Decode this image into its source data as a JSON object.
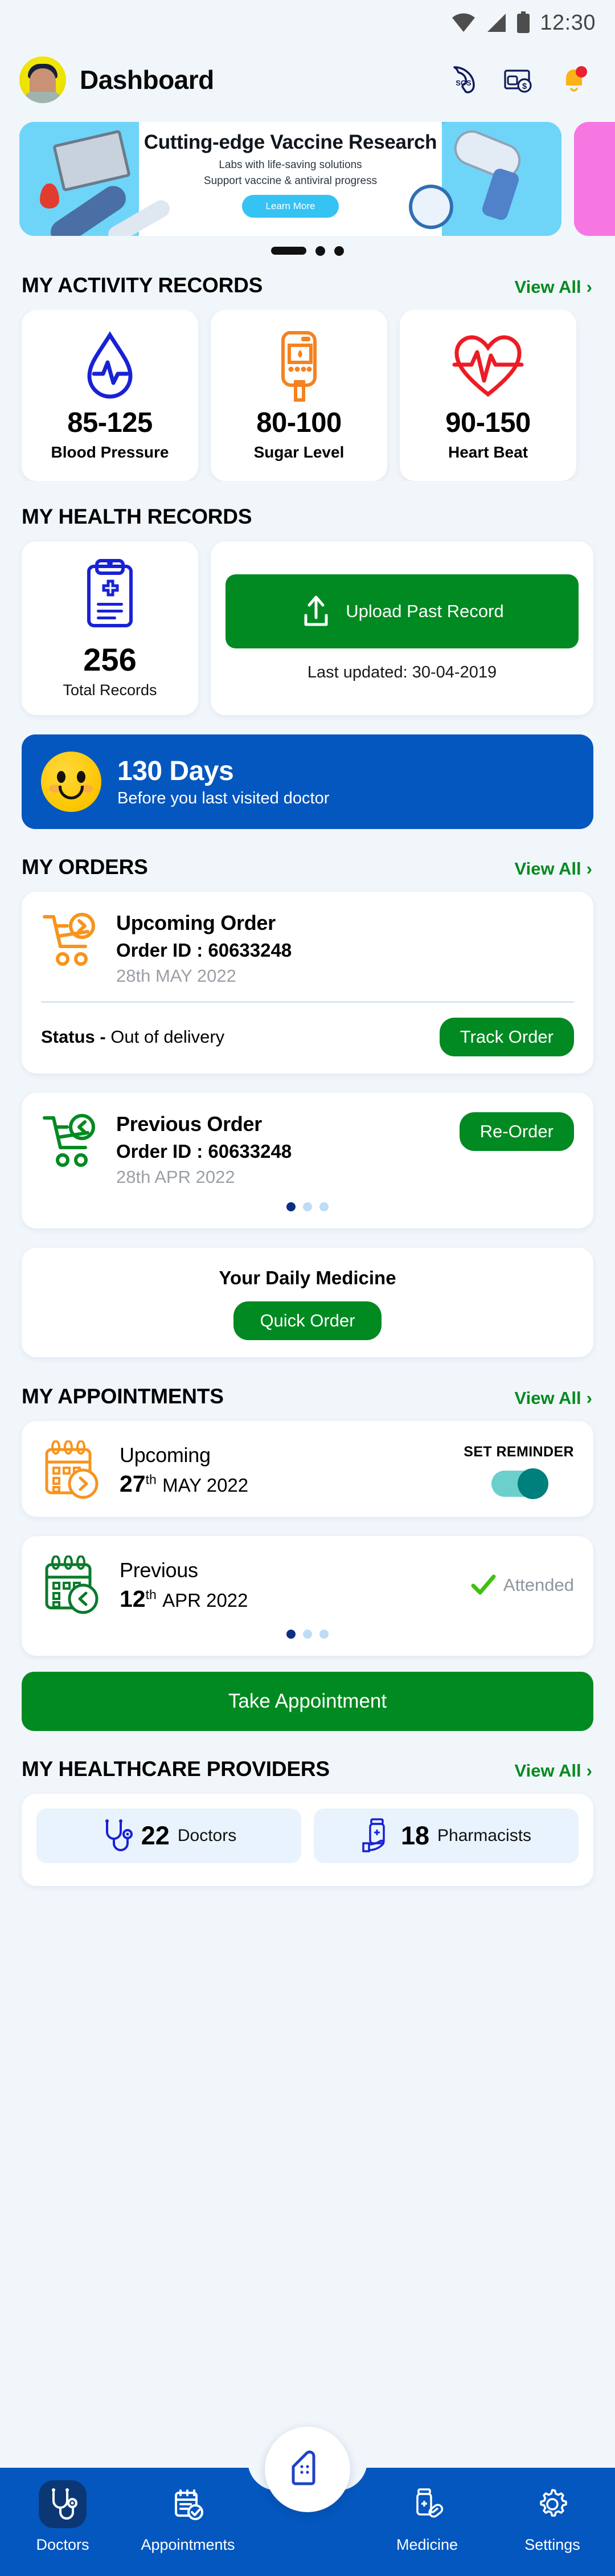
{
  "status_bar": {
    "time": "12:30",
    "icons": [
      "wifi-icon",
      "signal-icon",
      "battery-icon"
    ]
  },
  "header": {
    "title": "Dashboard",
    "avatar_name": "user-avatar",
    "icons": [
      {
        "name": "sos-call-icon",
        "label": "SOS"
      },
      {
        "name": "wallet-payment-icon",
        "label": ""
      },
      {
        "name": "notification-bell-icon",
        "label": ""
      }
    ]
  },
  "banner": {
    "title": "Cutting-edge Vaccine Research",
    "subtitle1": "Labs with life-saving solutions",
    "subtitle2": "Support vaccine & antiviral progress",
    "button": "Learn More",
    "slide_count": 3,
    "active_slide": 1
  },
  "activity": {
    "section_title": "MY ACTIVITY RECORDS",
    "view_all": "View All",
    "chevron": "›",
    "cards": [
      {
        "icon": "blood-pressure-droplet-icon",
        "value": "85-125",
        "label": "Blood Pressure",
        "color": "#1822d4"
      },
      {
        "icon": "glucometer-icon",
        "value": "80-100",
        "label": "Sugar Level",
        "color": "#f58220"
      },
      {
        "icon": "heartbeat-icon",
        "value": "90-150",
        "label": "Heart Beat",
        "color": "#ed1c24"
      }
    ]
  },
  "health_records": {
    "section_title": "MY HEALTH RECORDS",
    "total_number": "256",
    "total_label": "Total Records",
    "clipboard_icon": "medical-clipboard-icon",
    "upload_button": "Upload Past Record",
    "upload_icon": "upload-icon",
    "last_updated": "Last updated: 30-04-2019"
  },
  "days_banner": {
    "days": "130 Days",
    "subtitle": "Before you last visited doctor",
    "icon": "smiley-face-icon",
    "bg_color": "#0457be"
  },
  "orders": {
    "section_title": "MY ORDERS",
    "view_all": "View All",
    "upcoming": {
      "icon": "cart-forward-icon",
      "title": "Upcoming Order",
      "order_id": "Order ID : 60633248",
      "date": "28th MAY 2022",
      "status_label": "Status - ",
      "status_value": "Out of delivery",
      "action": "Track Order"
    },
    "previous": {
      "icon": "cart-back-icon",
      "title": "Previous Order",
      "order_id": "Order ID : 60633248",
      "date": "28th APR 2022",
      "action": "Re-Order"
    },
    "dots": {
      "count": 3,
      "active": 1
    },
    "daily_medicine": {
      "title": "Your Daily Medicine",
      "action": "Quick Order"
    }
  },
  "appointments": {
    "section_title": "MY APPOINTMENTS",
    "view_all": "View All",
    "upcoming": {
      "icon": "calendar-forward-icon",
      "title": "Upcoming",
      "day": "27",
      "ordinal": "th",
      "month_year": "MAY 2022",
      "reminder_label": "SET REMINDER",
      "reminder_on": true
    },
    "previous": {
      "icon": "calendar-back-icon",
      "title": "Previous",
      "day": "12",
      "ordinal": "th",
      "month_year": "APR 2022",
      "status": "Attended",
      "status_icon": "check-icon"
    },
    "dots": {
      "count": 3,
      "active": 1
    },
    "take_appointment": "Take Appointment"
  },
  "providers": {
    "section_title": "MY HEALTHCARE PROVIDERS",
    "view_all": "View All",
    "chips": [
      {
        "icon": "stethoscope-icon",
        "number": "22",
        "label": "Doctors"
      },
      {
        "icon": "medicine-bottle-hand-icon",
        "number": "18",
        "label": "Pharmacists"
      }
    ]
  },
  "bottom_nav": {
    "items": [
      {
        "name": "nav-doctors",
        "icon": "stethoscope-icon",
        "label": "Doctors",
        "active": true
      },
      {
        "name": "nav-appointments",
        "icon": "calendar-check-icon",
        "label": "Appointments",
        "active": false
      },
      {
        "name": "nav-medicine",
        "icon": "medicine-bottle-pill-icon",
        "label": "Medicine",
        "active": false
      },
      {
        "name": "nav-settings",
        "icon": "gear-icon",
        "label": "Settings",
        "active": false
      }
    ],
    "home_button": {
      "name": "home-fab",
      "icon": "home-icon"
    },
    "bg_color": "#0457be"
  },
  "theme": {
    "green": "#018a21",
    "blue": "#0457be",
    "page_bg": "#f1f6fb"
  }
}
